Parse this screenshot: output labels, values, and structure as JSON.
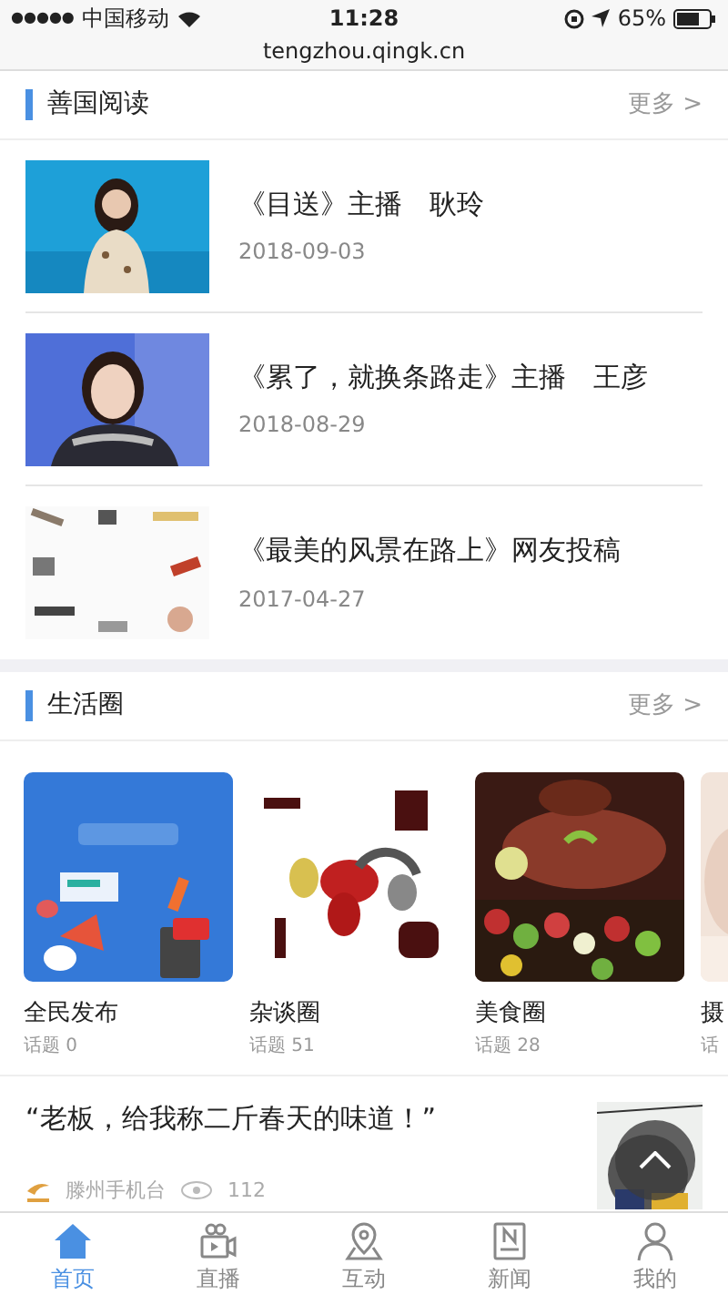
{
  "status_bar": {
    "signal": "●●●●●",
    "carrier": "中国移动",
    "time": "11:28",
    "battery": "65%"
  },
  "url": "tengzhou.qingk.cn",
  "reading": {
    "title": "善国阅读",
    "more": "更多 >",
    "items": [
      {
        "title": "《目送》主播　耿玲",
        "date": "2018-09-03"
      },
      {
        "title": "《累了，就换条路走》主播　王彦",
        "date": "2018-08-29"
      },
      {
        "title": "《最美的风景在路上》网友投稿",
        "date": "2017-04-27"
      }
    ]
  },
  "life": {
    "title": "生活圈",
    "more": "更多 >",
    "circles": [
      {
        "name": "全民发布",
        "topics": "话题 0"
      },
      {
        "name": "杂谈圈",
        "topics": "话题 51"
      },
      {
        "name": "美食圈",
        "topics": "话题 28"
      },
      {
        "name": "摄",
        "topics": "话"
      }
    ]
  },
  "post": {
    "text": "“老板，给我称二斤春天的味道！”",
    "source": "滕州手机台",
    "views": "112"
  },
  "tabs": [
    {
      "label": "首页",
      "selected": true
    },
    {
      "label": "直播",
      "selected": false
    },
    {
      "label": "互动",
      "selected": false
    },
    {
      "label": "新闻",
      "selected": false
    },
    {
      "label": "我的",
      "selected": false
    }
  ]
}
